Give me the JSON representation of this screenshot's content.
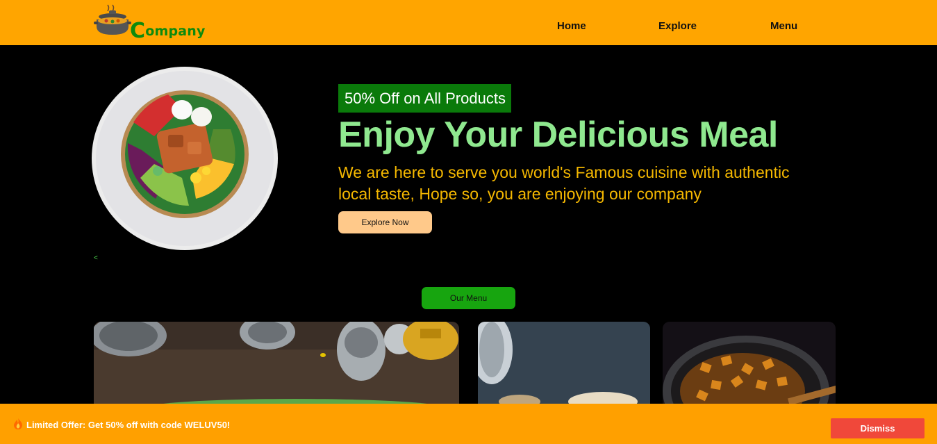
{
  "header": {
    "logo_text_initial": "C",
    "logo_text_rest": "ompany",
    "nav": [
      "Home",
      "Explore",
      "Menu"
    ]
  },
  "hero": {
    "badge": "50% Off on All Products",
    "title": "Enjoy Your Delicious Meal",
    "description": "We are here to serve you world's Famous cuisine with authentic local taste, Hope so, you are enjoying our company",
    "cta_label": "Explore Now",
    "prev_arrow": "<"
  },
  "menu_section": {
    "button_label": "Our Menu"
  },
  "offer_bar": {
    "text": "Limited Offer: Get 50% off with code WELUV50!",
    "dismiss_label": "Dismiss"
  },
  "colors": {
    "header_bg": "#ffa500",
    "badge_bg": "#0a7a0a",
    "title": "#8fe88f",
    "description": "#f5b800",
    "cta_bg": "#ffc98a",
    "menu_btn_bg": "#17a50f",
    "offer_bg": "#ffa000",
    "dismiss_bg": "#f0483a"
  },
  "icons": {
    "logo": "cooking-pot-icon",
    "offer": "flame-icon"
  }
}
